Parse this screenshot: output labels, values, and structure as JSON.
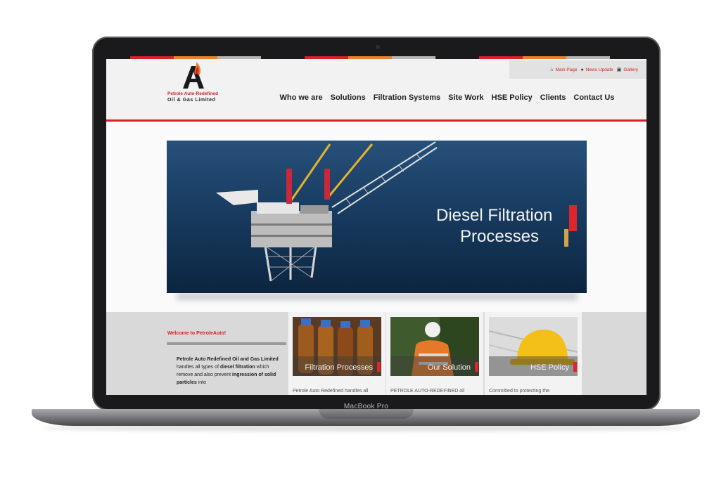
{
  "device": {
    "label": "MacBook Pro"
  },
  "colors": {
    "brand_red": "#d72027",
    "accent_orange": "#e8812d",
    "accent_gray": "#b5b5b5",
    "gold": "#d2a24c"
  },
  "topbar": {
    "links": [
      {
        "icon": "home-icon",
        "label": "Main Page"
      },
      {
        "icon": "user-icon",
        "label": "News Update"
      },
      {
        "icon": "image-icon",
        "label": "Gallery"
      }
    ]
  },
  "logo": {
    "line1": "Petrole Auto-Redefined",
    "line2": "Oil & Gas Limited"
  },
  "nav": {
    "items": [
      "Who we are",
      "Solutions",
      "Filtration Systems",
      "Site Work",
      "HSE Policy",
      "Clients",
      "Contact Us"
    ]
  },
  "hero": {
    "title_line1": "Diesel Filtration",
    "title_line2": "Processes"
  },
  "welcome": {
    "title": "Welcome to PetroleAuto!",
    "t1": "Petrole Auto Redefined Oil and Gas Limited",
    "t2": " handles all types of ",
    "t3": "diesel filtration",
    "t4": " which remove and also prevent ",
    "t5": "ingression of solid particles",
    "t6": " into"
  },
  "cards": [
    {
      "label": "Filtration Processes",
      "text": "Petrole Auto Redefined handles all"
    },
    {
      "label": "Our Solution",
      "text": "PETROLE AUTO-REDEFINED oil"
    },
    {
      "label": "HSE Policy",
      "text": "Committed to protecting the"
    }
  ]
}
